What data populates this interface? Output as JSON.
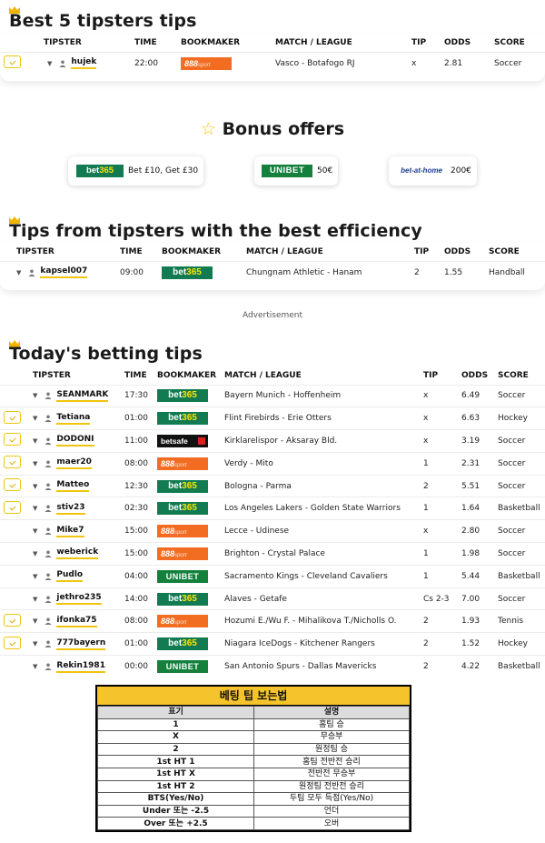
{
  "best5": {
    "title": "Best 5 tipsters tips",
    "headers": {
      "tipster": "TIPSTER",
      "time": "TIME",
      "bookmaker": "BOOKMAKER",
      "match": "MATCH / LEAGUE",
      "tip": "TIP",
      "odds": "ODDS",
      "score": "SCORE"
    },
    "rows": [
      {
        "badge": true,
        "tipster": "hujek",
        "time": "22:00",
        "bookmaker": "888sport",
        "match": "Vasco - Botafogo RJ",
        "tip": "x",
        "odds": "2.81",
        "score": "Soccer"
      }
    ]
  },
  "bonus": {
    "title": "Bonus offers",
    "offers": [
      {
        "brand": "bet365",
        "text": "Bet £10, Get £30"
      },
      {
        "brand": "UNIBET",
        "text": "50€"
      },
      {
        "brand": "bet-at-home",
        "text": "200€"
      }
    ]
  },
  "efficiency": {
    "title": "Tips from tipsters with the best efficiency",
    "headers": {
      "tipster": "TIPSTER",
      "time": "TIME",
      "bookmaker": "BOOKMAKER",
      "match": "MATCH / LEAGUE",
      "tip": "TIP",
      "odds": "ODDS",
      "score": "SCORE"
    },
    "rows": [
      {
        "badge": false,
        "tipster": "kapsel007",
        "time": "09:00",
        "bookmaker": "bet365",
        "match": "Chungnam Athletic - Hanam",
        "tip": "2",
        "odds": "1.55",
        "score": "Handball"
      }
    ]
  },
  "advertisement": "Advertisement",
  "today": {
    "title": "Today's betting tips",
    "headers": {
      "tipster": "TIPSTER",
      "time": "TIME",
      "bookmaker": "BOOKMAKER",
      "match": "MATCH / LEAGUE",
      "tip": "TIP",
      "odds": "ODDS",
      "score": "SCORE"
    },
    "rows": [
      {
        "badge": false,
        "tipster": "SEANMARK",
        "time": "17:30",
        "bookmaker": "bet365",
        "match": "Bayern Munich - Hoffenheim",
        "tip": "x",
        "odds": "6.49",
        "score": "Soccer"
      },
      {
        "badge": true,
        "tipster": "Tetiana",
        "time": "01:00",
        "bookmaker": "bet365",
        "match": "Flint Firebirds - Erie Otters",
        "tip": "x",
        "odds": "6.63",
        "score": "Hockey"
      },
      {
        "badge": true,
        "tipster": "DODONI",
        "time": "11:00",
        "bookmaker": "betsafe",
        "match": "Kirklarelispor - Aksaray Bld.",
        "tip": "x",
        "odds": "3.19",
        "score": "Soccer"
      },
      {
        "badge": true,
        "tipster": "maer20",
        "time": "08:00",
        "bookmaker": "888sport",
        "match": "Verdy - Mito",
        "tip": "1",
        "odds": "2.31",
        "score": "Soccer"
      },
      {
        "badge": true,
        "tipster": "Matteo",
        "time": "12:30",
        "bookmaker": "bet365",
        "match": "Bologna - Parma",
        "tip": "2",
        "odds": "5.51",
        "score": "Soccer"
      },
      {
        "badge": true,
        "tipster": "stiv23",
        "time": "02:30",
        "bookmaker": "bet365",
        "match": "Los Angeles Lakers - Golden State Warriors",
        "tip": "1",
        "odds": "1.64",
        "score": "Basketball"
      },
      {
        "badge": false,
        "tipster": "Mike7",
        "time": "15:00",
        "bookmaker": "888sport",
        "match": "Lecce - Udinese",
        "tip": "x",
        "odds": "2.80",
        "score": "Soccer"
      },
      {
        "badge": false,
        "tipster": "weberick",
        "time": "15:00",
        "bookmaker": "888sport",
        "match": "Brighton - Crystal Palace",
        "tip": "1",
        "odds": "1.98",
        "score": "Soccer"
      },
      {
        "badge": false,
        "tipster": "Pudlo",
        "time": "04:00",
        "bookmaker": "UNIBET",
        "match": "Sacramento Kings - Cleveland Cavaliers",
        "tip": "1",
        "odds": "5.44",
        "score": "Basketball"
      },
      {
        "badge": false,
        "tipster": "jethro235",
        "time": "14:00",
        "bookmaker": "bet365",
        "match": "Alaves - Getafe",
        "tip": "Cs 2-3",
        "odds": "7.00",
        "score": "Soccer"
      },
      {
        "badge": true,
        "tipster": "ifonka75",
        "time": "08:00",
        "bookmaker": "888sport",
        "match": "Hozumi E./Wu F. - Mihalikova T./Nicholls O.",
        "tip": "2",
        "odds": "1.93",
        "score": "Tennis"
      },
      {
        "badge": true,
        "tipster": "777bayern",
        "time": "01:00",
        "bookmaker": "bet365",
        "match": "Niagara IceDogs - Kitchener Rangers",
        "tip": "2",
        "odds": "1.52",
        "score": "Hockey"
      },
      {
        "badge": false,
        "tipster": "Rekin1981",
        "time": "00:00",
        "bookmaker": "UNIBET",
        "match": "San Antonio Spurs - Dallas Mavericks",
        "tip": "2",
        "odds": "4.22",
        "score": "Basketball"
      }
    ]
  },
  "legend": {
    "title": "베팅 팁 보는법",
    "header": {
      "key": "표기",
      "desc": "설명"
    },
    "rows": [
      {
        "key": "1",
        "desc": "홈팀 승"
      },
      {
        "key": "X",
        "desc": "무승부"
      },
      {
        "key": "2",
        "desc": "원정팀 승"
      },
      {
        "key": "1st HT 1",
        "desc": "홈팀 전반전 승리"
      },
      {
        "key": "1st HT X",
        "desc": "전반전 무승부"
      },
      {
        "key": "1st HT 2",
        "desc": "원정팀 전반전 승리"
      },
      {
        "key": "BTS(Yes/No)",
        "desc": "두팀 모두 득점(Yes/No)"
      },
      {
        "key": "Under 또는 -2.5",
        "desc": "언더"
      },
      {
        "key": "Over 또는 +2.5",
        "desc": "오버"
      }
    ]
  },
  "colors": {
    "accent": "#f1c40f",
    "bet365": "#127b51",
    "888sport": "#f26d21",
    "unibet": "#14803c",
    "legend_title": "#f5c42c"
  }
}
